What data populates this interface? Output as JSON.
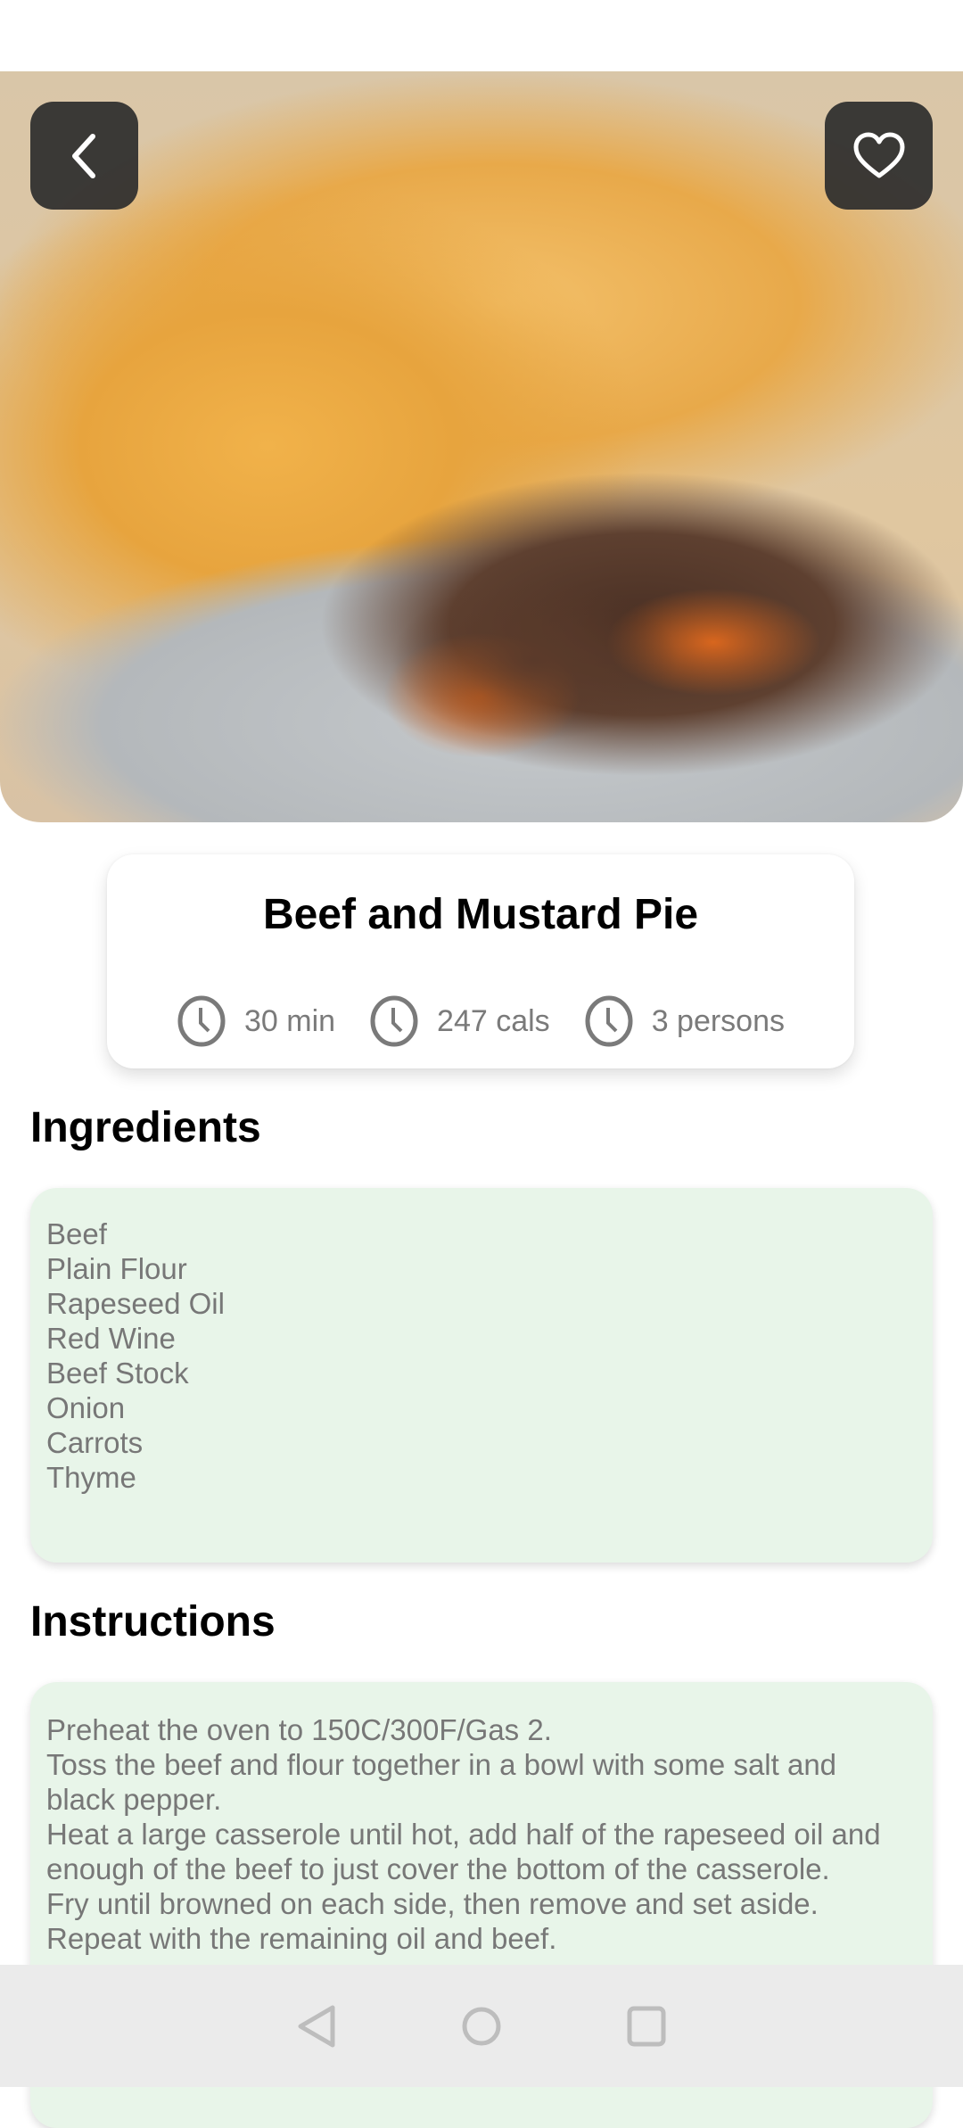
{
  "recipe": {
    "title": "Beef and Mustard Pie",
    "time": "30 min",
    "calories": "247 cals",
    "servings": "3 persons"
  },
  "sections": {
    "ingredients": "Ingredients",
    "instructions": "Instructions"
  },
  "ingredients": [
    "Beef",
    "Plain Flour",
    "Rapeseed Oil",
    "Red Wine",
    "Beef Stock",
    "Onion",
    "Carrots",
    "Thyme"
  ],
  "instructions": [
    "Preheat the oven to 150C/300F/Gas 2.",
    "Toss the beef and flour together in a bowl with some salt and black pepper.",
    "Heat a large casserole until hot, add half of the rapeseed oil and enough of the beef to just cover the bottom of the casserole.",
    "Fry until browned on each side, then remove and set aside.",
    "Repeat with the remaining oil and beef."
  ],
  "colors": {
    "box_bg": "#e8f5e9",
    "button_bg": "#2d2d2d"
  }
}
